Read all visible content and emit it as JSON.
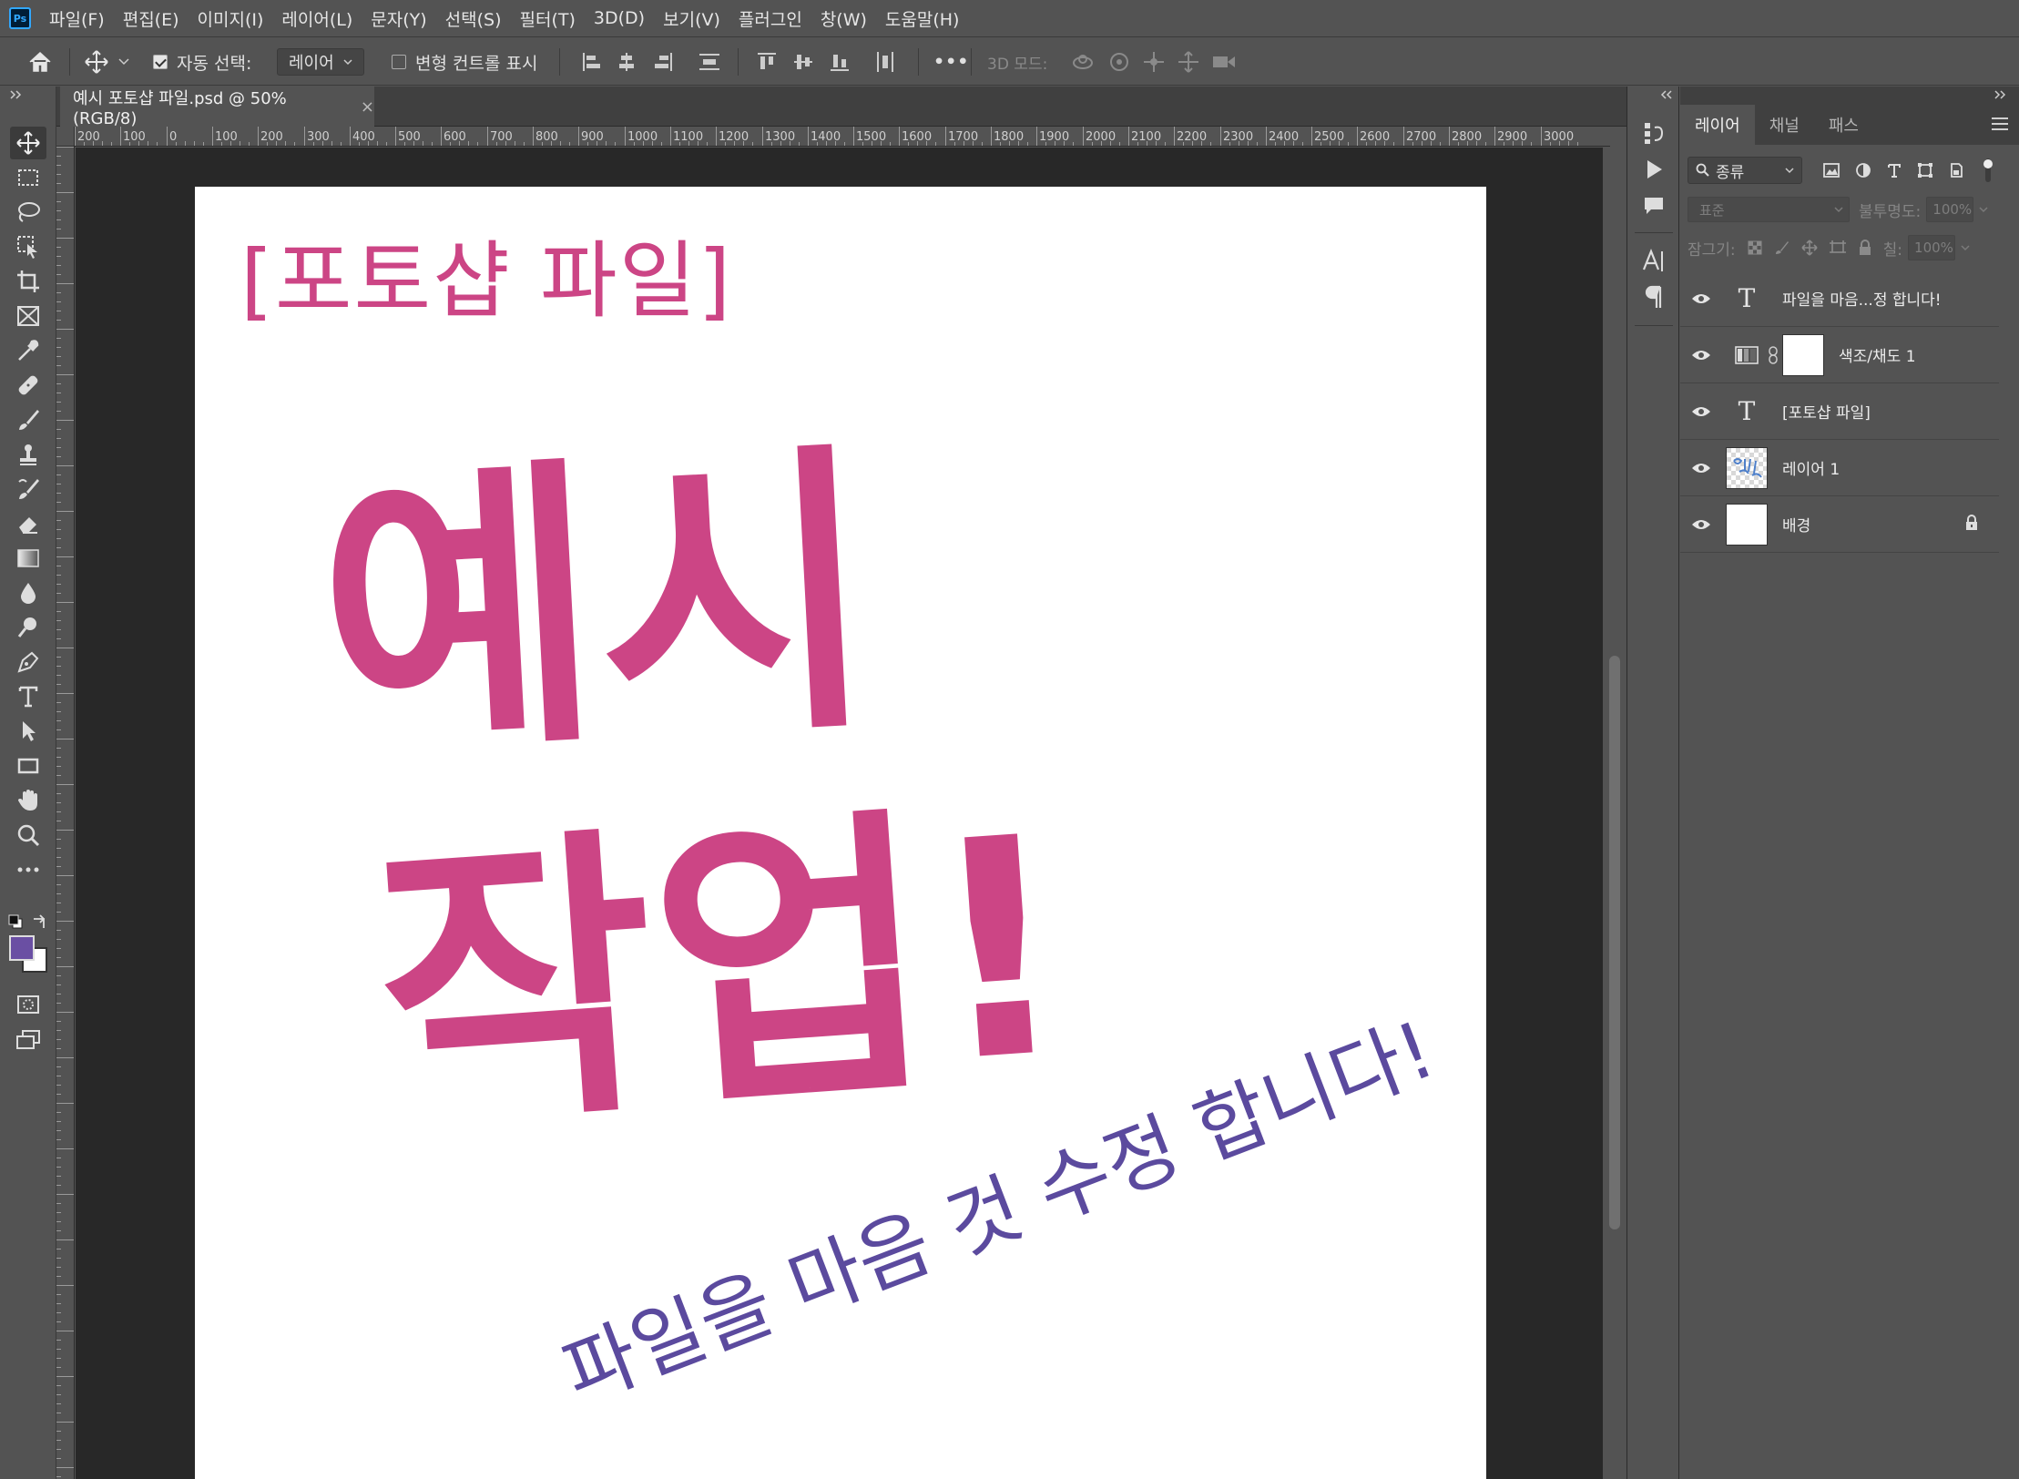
{
  "app": {
    "logo": "Ps"
  },
  "menu": [
    "파일(F)",
    "편집(E)",
    "이미지(I)",
    "레이어(L)",
    "문자(Y)",
    "선택(S)",
    "필터(T)",
    "3D(D)",
    "보기(V)",
    "플러그인",
    "창(W)",
    "도움말(H)"
  ],
  "options": {
    "auto_select_label": "자동 선택:",
    "auto_select_checked": true,
    "auto_select_target": "레이어",
    "transform_label": "변형 컨트롤 표시",
    "transform_checked": false,
    "mode_3d_label": "3D 모드:",
    "more": "•••"
  },
  "document": {
    "tab_title": "예시 포토샵 파일.psd @ 50% (RGB/8)",
    "close": "×",
    "ruler_labels": [
      "200",
      "100",
      "0",
      "100",
      "200",
      "300",
      "400",
      "500",
      "600",
      "700",
      "800",
      "900",
      "1000",
      "1100",
      "1200",
      "1300",
      "1400",
      "1500",
      "1600",
      "1700",
      "1800",
      "1900",
      "2000",
      "2100",
      "2200",
      "2300",
      "2400",
      "2500",
      "2600",
      "2700",
      "2800",
      "2900",
      "3000"
    ],
    "canvas_title": "[포토샵 파일]",
    "canvas_big_line1": "예시",
    "canvas_big_line2": "작업!",
    "canvas_subtitle": "파일을 마음 것 수정 합니다!"
  },
  "colors": {
    "foreground": "#6a4fa3",
    "background": "#ffffff",
    "pink": "#cc4585",
    "purple": "#5b4a9e"
  },
  "tools": [
    "move-icon",
    "marquee-icon",
    "lasso-icon",
    "object-select-icon",
    "crop-icon",
    "frame-icon",
    "eyedropper-icon",
    "healing-icon",
    "brush-icon",
    "stamp-icon",
    "history-brush-icon",
    "eraser-icon",
    "gradient-icon",
    "blur-icon",
    "dodge-icon",
    "pen-icon",
    "type-icon",
    "path-select-icon",
    "rectangle-icon",
    "hand-icon",
    "zoom-icon",
    "more-tools-icon"
  ],
  "layers_panel": {
    "tabs": [
      "레이어",
      "채널",
      "패스"
    ],
    "filter_label": "종류",
    "blend_mode": "표준",
    "opacity_label": "불투명도:",
    "opacity_value": "100%",
    "lock_label": "잠그기:",
    "fill_label": "칠:",
    "fill_value": "100%",
    "layers": [
      {
        "name": "파일을 마음...정 합니다!",
        "type": "text"
      },
      {
        "name": "색조/채도 1",
        "type": "adjustment"
      },
      {
        "name": "[포토샵 파일]",
        "type": "text"
      },
      {
        "name": "레이어 1",
        "type": "pixel"
      },
      {
        "name": "배경",
        "type": "background",
        "locked": true
      }
    ]
  }
}
